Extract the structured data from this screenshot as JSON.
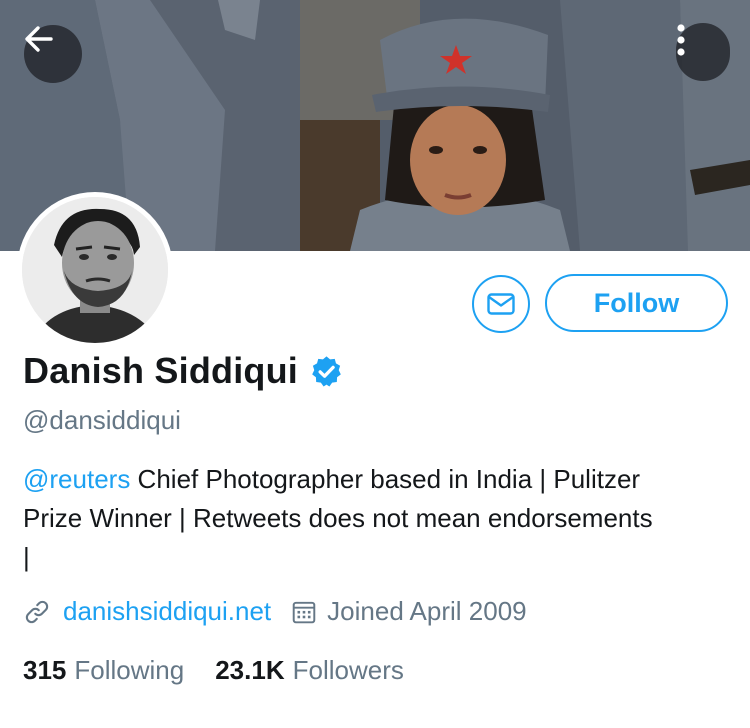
{
  "profile": {
    "name": "Danish Siddiqui",
    "handle": "@dansiddiqui",
    "bio_mention": "@reuters",
    "bio_line1_rest": " Chief Photographer based in India | Pulitzer",
    "bio_line2": "Prize Winner | Retweets does not mean endorsements",
    "bio_line3": "|",
    "website": "danishsiddiqui.net",
    "joined": "Joined April 2009",
    "following_count": "315",
    "following_label": "Following",
    "followers_count": "23.1K",
    "followers_label": "Followers"
  },
  "actions": {
    "follow_label": "Follow"
  },
  "icons": {
    "back": "back-arrow-icon",
    "more": "more-vertical-icon",
    "message": "envelope-icon",
    "verified": "verified-badge-icon",
    "link": "link-icon",
    "calendar": "calendar-icon"
  },
  "colors": {
    "accent": "#1da1f2",
    "secondary_text": "#657786",
    "primary_text": "#14171a"
  }
}
